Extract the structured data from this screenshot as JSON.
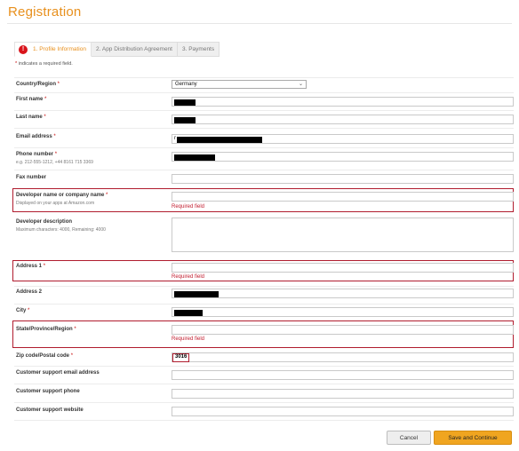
{
  "page": {
    "title": "Registration"
  },
  "tabs": [
    {
      "label": "1. Profile Information",
      "active": true
    },
    {
      "label": "2. App Distribution Agreement",
      "active": false
    },
    {
      "label": "3. Payments",
      "active": false
    }
  ],
  "required_note": {
    "star": "*",
    "text": " indicates a required field."
  },
  "fields": {
    "country": {
      "label": "Country/Region",
      "value": "Germany"
    },
    "first_name": {
      "label": "First name"
    },
    "last_name": {
      "label": "Last name"
    },
    "email": {
      "label": "Email address",
      "value_prefix": "r"
    },
    "phone": {
      "label": "Phone number",
      "hint": "e.g. 212-555-1212, +44 8161 715 3369"
    },
    "fax": {
      "label": "Fax number"
    },
    "developer_name": {
      "label": "Developer name or company name",
      "hint": "Displayed on your apps at Amazon.com",
      "error": "Required field"
    },
    "developer_description": {
      "label": "Developer description",
      "hint": "Maximum characters: 4000, Remaining: 4000"
    },
    "address1": {
      "label": "Address 1",
      "error": "Required field"
    },
    "address2": {
      "label": "Address 2"
    },
    "city": {
      "label": "City"
    },
    "state": {
      "label": "State/Province/Region",
      "error": "Required field"
    },
    "zip": {
      "label": "Zip code/Postal code",
      "value": "3016"
    },
    "support_email": {
      "label": "Customer support email address"
    },
    "support_phone": {
      "label": "Customer support phone"
    },
    "support_website": {
      "label": "Customer support website"
    }
  },
  "required_star": "*",
  "buttons": {
    "cancel": "Cancel",
    "save": "Save and Continue"
  },
  "colors": {
    "accent": "#e8901d",
    "error": "#b01c2e",
    "primary_button": "#f0a520"
  },
  "icons": {
    "error": "exclamation-circle-icon",
    "dropdown": "chevron-down-icon"
  }
}
